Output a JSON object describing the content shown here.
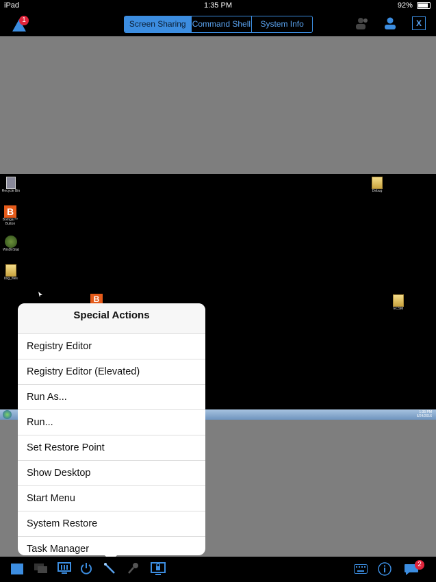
{
  "status": {
    "device": "iPad",
    "time": "1:35 PM",
    "battery": "92%"
  },
  "header": {
    "notification_count": "1",
    "tabs": [
      {
        "label": "Screen Sharing"
      },
      {
        "label": "Command Shell"
      },
      {
        "label": "System Info"
      }
    ],
    "close_label": "X"
  },
  "desktop": {
    "icons": [
      {
        "label": "Recycle Bin"
      },
      {
        "label": "Bomgar™ Button"
      },
      {
        "label": "WinDirStat"
      },
      {
        "label": "bxg_files"
      },
      {
        "label": "Debug"
      },
      {
        "label": "ECSM"
      }
    ],
    "clock": "1:35 PM",
    "date": "6/24/2016"
  },
  "popup": {
    "title": "Special Actions",
    "items": [
      "Registry Editor",
      "Registry Editor (Elevated)",
      "Run As...",
      "Run...",
      "Set Restore Point",
      "Show Desktop",
      "Start Menu",
      "System Restore",
      "Task Manager"
    ]
  },
  "bottom": {
    "chat_count": "2"
  },
  "colors": {
    "accent": "#3c8de0",
    "badge": "#e0243b"
  }
}
